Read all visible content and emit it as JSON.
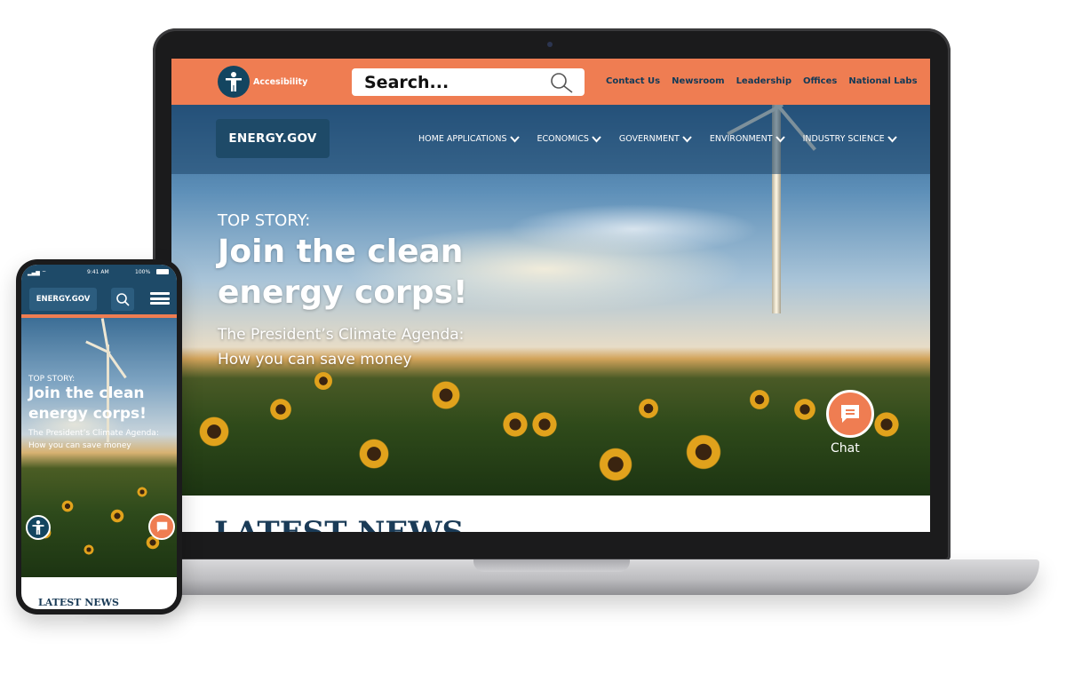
{
  "desktop": {
    "topbar": {
      "accessibility_label": "Accesibility",
      "search_placeholder": "Search...",
      "links": [
        "Contact Us",
        "Newsroom",
        "Leadership",
        "Offices",
        "National Labs"
      ]
    },
    "nav": {
      "logo": "ENERGY.GOV",
      "items": [
        "HOME APPLICATIONS",
        "ECONOMICS",
        "GOVERNMENT",
        "ENVIRONMENT",
        "INDUSTRY SCIENCE"
      ]
    },
    "hero": {
      "eyebrow": "TOP STORY:",
      "title": "Join the clean energy corps!",
      "subtitle": "The President’s Climate Agenda: How you can save money"
    },
    "chat_label": "Chat",
    "news_heading": "LATEST NEWS"
  },
  "mobile": {
    "status_time": "9:41 AM",
    "status_battery": "100%",
    "logo": "ENERGY.GOV",
    "hero": {
      "eyebrow": "TOP STORY:",
      "title": "Join the clean energy corps!",
      "subtitle": "The President’s Climate Agenda: How you can save money"
    },
    "news_heading": "LATEST NEWS"
  },
  "colors": {
    "accent_orange": "#ef7d52",
    "navy": "#1e4a68",
    "dark_navy": "#134560",
    "heading_blue": "#1a3b57"
  },
  "icons": [
    "accessibility-icon",
    "search-icon",
    "chevron-down-icon",
    "chat-icon",
    "menu-icon"
  ]
}
